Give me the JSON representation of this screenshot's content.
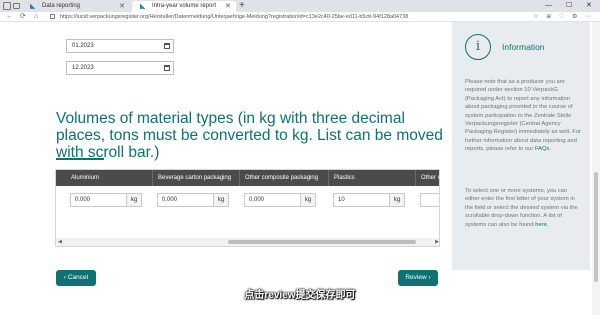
{
  "browser": {
    "tabs": [
      {
        "label": "Data reporting",
        "active": false
      },
      {
        "label": "Intra-year volume report",
        "active": true
      }
    ],
    "new_tab": "+",
    "url": "https://lucid.verpackungsregister.org/Hersteller/Datenmeldung/Unterjaehrige-Meldung?registrationId=c13e2c40-25be-ed11-b5cb-94f128a04738",
    "window_controls": [
      "—",
      "☐",
      "✕"
    ]
  },
  "dates": {
    "start": "01.2023",
    "end": "12.2023"
  },
  "section": {
    "title": "Volumes of material types (in kg with three decimal places, tons must be converted to kg. List can be moved with scroll bar.)"
  },
  "table": {
    "headers": [
      "Aluminium",
      "Beverage carton packaging",
      "Other composite packaging",
      "Plastics",
      "Other m"
    ],
    "values": [
      "0.000",
      "0.000",
      "0.000",
      "10"
    ],
    "unit": "kg"
  },
  "buttons": {
    "cancel": "‹  Cancel",
    "review": "Review  ›"
  },
  "subtitle": "点击review提交保存即可",
  "info": {
    "icon": "i",
    "title": "Information",
    "p1": "Please note that as a producer you are required under section 10 VerpackG (Packaging Act) to report any information about packaging provided in the course of system participation to the Zentrale Stelle Verpackungsregister (Central Agency Packaging Register) immediately as well. For further information about data reporting and reports, please refer to our",
    "p1_link": "FAQs",
    "p1_end": ".",
    "p2": "To select one or more systems, you can either enter the first letter of your system in the field or select the desired system via the scrollable drop-down function. A list of systems can also be found",
    "p2_link": "here",
    "p2_end": "."
  }
}
